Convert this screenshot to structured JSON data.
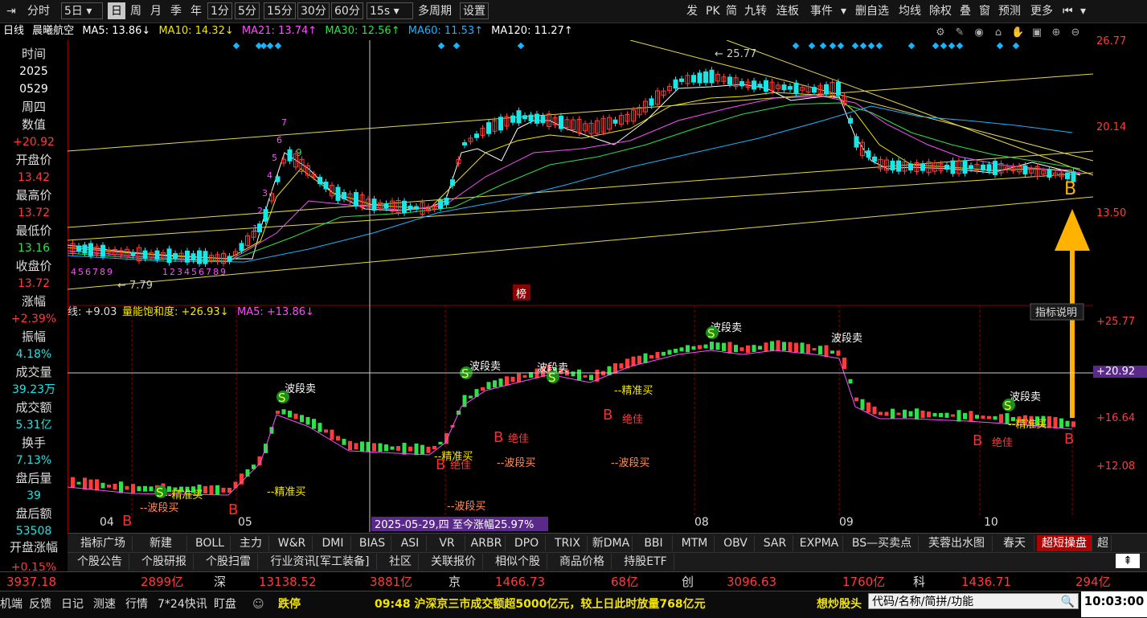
{
  "toolbar": {
    "items": [
      "分时",
      "5日",
      "日",
      "周",
      "月",
      "季",
      "年",
      "1分",
      "5分",
      "15分",
      "30分",
      "60分",
      "15s",
      "多周期",
      "设置"
    ],
    "right_items": [
      "发",
      "PK",
      "简",
      "九转",
      "连板",
      "事件",
      "删自选",
      "均线",
      "除权",
      "叠",
      "窗",
      "预测",
      "更多"
    ],
    "period_dropdown": "5日",
    "interval_dropdown": "15s"
  },
  "info": {
    "period": "日线",
    "stock_name": "晨曦航空",
    "ma5": "MA5: 13.86↓",
    "ma10": "MA10: 14.32↓",
    "ma21": "MA21: 13.74↑",
    "ma30": "MA30: 12.56↑",
    "ma60": "MA60: 11.53↑",
    "ma120": "MA120: 11.27↑"
  },
  "left_panel": [
    {
      "label": "时间",
      "value": "2025",
      "value2": "0529",
      "color": "white"
    },
    {
      "label": "周四",
      "value": null
    },
    {
      "label": "数值",
      "value": "+20.92",
      "color": "red"
    },
    {
      "label": "开盘价",
      "value": "13.42",
      "color": "red"
    },
    {
      "label": "最高价",
      "value": "13.72",
      "color": "red"
    },
    {
      "label": "最低价",
      "value": "13.16",
      "color": "green"
    },
    {
      "label": "收盘价",
      "value": "13.72",
      "color": "red"
    },
    {
      "label": "涨幅",
      "value": "+2.39%",
      "color": "red"
    },
    {
      "label": "振幅",
      "value": "4.18%",
      "color": "cyan"
    },
    {
      "label": "成交量",
      "value": "39.23万",
      "color": "cyan"
    },
    {
      "label": "成交额",
      "value": "5.31亿",
      "color": "cyan"
    },
    {
      "label": "换手",
      "value": "7.13%",
      "color": "cyan"
    },
    {
      "label": "盘后量",
      "value": "39",
      "color": "cyan"
    },
    {
      "label": "盘后额",
      "value": "53508",
      "color": "cyan"
    },
    {
      "label": "开盘涨幅",
      "value": "+0.15%",
      "color": "red"
    }
  ],
  "price_axis": [
    "26.77",
    "20.14",
    "13.50"
  ],
  "indicator_axis": [
    "+25.77",
    "+20.92",
    "+16.64",
    "+12.08"
  ],
  "indicator_header": {
    "line1": "线: +9.03",
    "line2": "量能饱和度: +26.93↓",
    "line3": "MA5: +13.86↓",
    "help": "指标说明"
  },
  "date_labels": [
    "04",
    "05",
    "08",
    "09",
    "10"
  ],
  "range_label": "2025-05-29,四 至今涨幅25.97%",
  "chart_labels": {
    "high_price": "25.77",
    "low_price": "7.79",
    "bang": "榜",
    "b_signal": "B",
    "seq_low": [
      "4",
      "5",
      "6",
      "7",
      "8",
      "9"
    ],
    "seq_mid": [
      "1",
      "2",
      "3",
      "4",
      "5",
      "6",
      "7",
      "8",
      "9"
    ],
    "seq_up": [
      "1",
      "2",
      "3",
      "4",
      "5",
      "6",
      "7"
    ],
    "seq_up_end": "9",
    "bodu_sell": "波段卖",
    "jingzhun_buy": "--精准买",
    "bodu_buy": "--波段买",
    "jue_jia": "绝佳",
    "sell_mark": "S",
    "buy_mark": "B"
  },
  "tabs1": [
    "指标广场",
    "新建",
    "BOLL",
    "主力",
    "W&R",
    "DMI",
    "BIAS",
    "ASI",
    "VR",
    "ARBR",
    "DPO",
    "TRIX",
    "新DMA",
    "BBI",
    "MTM",
    "OBV",
    "SAR",
    "EXPMA",
    "BS—买卖点",
    "芙蓉出水图",
    "春天",
    "超短操盘",
    "超"
  ],
  "tabs2": [
    "个股公告",
    "个股研报",
    "个股扫雷",
    "行业资讯[军工装备]",
    "社区",
    "关联报价",
    "相似个股",
    "商品价格",
    "持股ETF"
  ],
  "index_bar": [
    {
      "name": "",
      "value": "3937.18",
      "amount": "2899亿"
    },
    {
      "name": "深",
      "value": "13138.52",
      "amount": "3881亿"
    },
    {
      "name": "京",
      "value": "1466.73",
      "amount": "68亿"
    },
    {
      "name": "创",
      "value": "3096.63",
      "amount": "1760亿"
    },
    {
      "name": "科",
      "value": "1436.71",
      "amount": "294亿"
    }
  ],
  "status_bar": {
    "items": [
      "机端",
      "反馈",
      "日记",
      "测速",
      "行情",
      "7*24快讯",
      "盯盘"
    ],
    "alert": "跌停",
    "news": "09:48 沪深京三市成交额超5000亿元，较上日此时放量768亿元",
    "promo": "想炒股头",
    "search_placeholder": "代码/名称/简拼/功能",
    "clock": "10:03:00"
  },
  "colors": {
    "up": "#ff3b3b",
    "down": "#19e6e6",
    "ma5": "#ffffff",
    "ma10": "#f2e600",
    "ma21": "#ff4cff",
    "ma30": "#2ee04a",
    "ma60": "#19b4ff",
    "channel": "#e6d84a",
    "arrow": "#ffb300"
  }
}
